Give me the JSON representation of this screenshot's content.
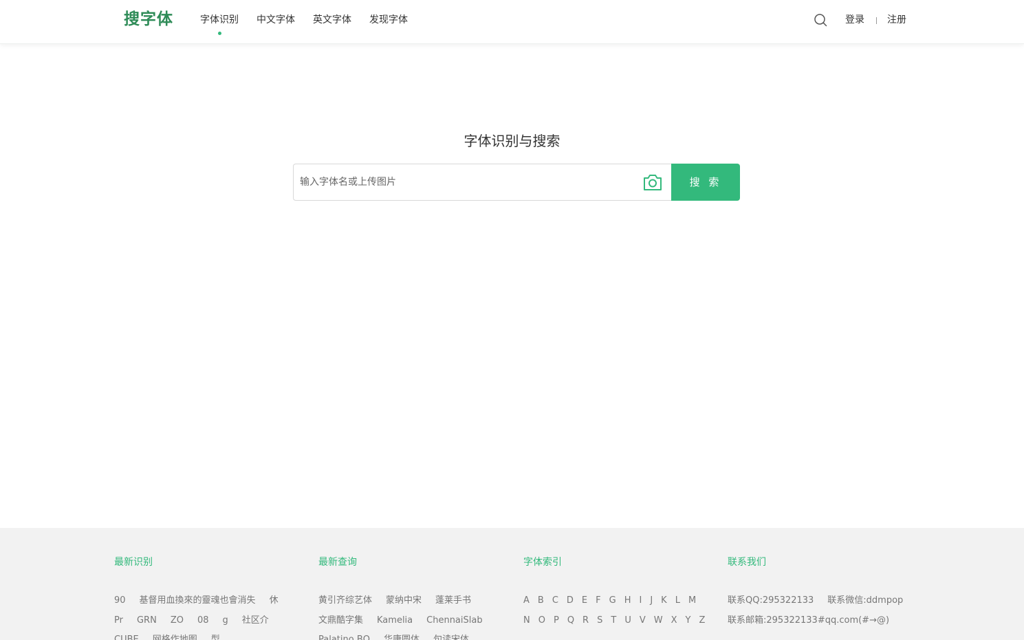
{
  "header": {
    "logo": "搜字体",
    "nav": [
      {
        "label": "字体识别",
        "active": true
      },
      {
        "label": "中文字体",
        "active": false
      },
      {
        "label": "英文字体",
        "active": false
      },
      {
        "label": "发现字体",
        "active": false
      }
    ],
    "login": "登录",
    "register": "注册"
  },
  "hero": {
    "title": "字体识别与搜索",
    "search_placeholder": "输入字体名或上传图片",
    "search_button": "搜 索"
  },
  "footer": {
    "recent_recognition": {
      "title": "最新识别",
      "rows": [
        [
          "90",
          "基督用血換來的靈魂也會消失",
          "休"
        ],
        [
          "Pr",
          "GRN",
          "ZO",
          "08",
          "g",
          "社区介"
        ],
        [
          "CUBE",
          "网格作地图",
          "型"
        ]
      ]
    },
    "recent_search": {
      "title": "最新查询",
      "rows": [
        [
          "黄引齐综艺体",
          "蒙纳中宋",
          "蓬莱手书"
        ],
        [
          "文鼎酷字集",
          "Kamelia",
          "ChennaiSlab"
        ],
        [
          "Palatino BQ",
          "华康圆体",
          "句读宋体"
        ]
      ]
    },
    "font_index": {
      "title": "字体索引",
      "rows": [
        [
          "A",
          "B",
          "C",
          "D",
          "E",
          "F",
          "G",
          "H",
          "I",
          "J",
          "K",
          "L",
          "M"
        ],
        [
          "N",
          "O",
          "P",
          "Q",
          "R",
          "S",
          "T",
          "U",
          "V",
          "W",
          "X",
          "Y",
          "Z"
        ]
      ]
    },
    "contact": {
      "title": "联系我们",
      "rows": [
        [
          "联系QQ:295322133",
          "联系微信:ddmpop"
        ],
        [
          "联系邮箱:295322133#qq.com(#→@)"
        ]
      ]
    }
  },
  "colors": {
    "brand": "#2e8b57",
    "accent": "#33b97c",
    "footer_bg": "#f2f2f2"
  },
  "icons": {
    "search": "search-icon",
    "camera": "camera-icon"
  }
}
